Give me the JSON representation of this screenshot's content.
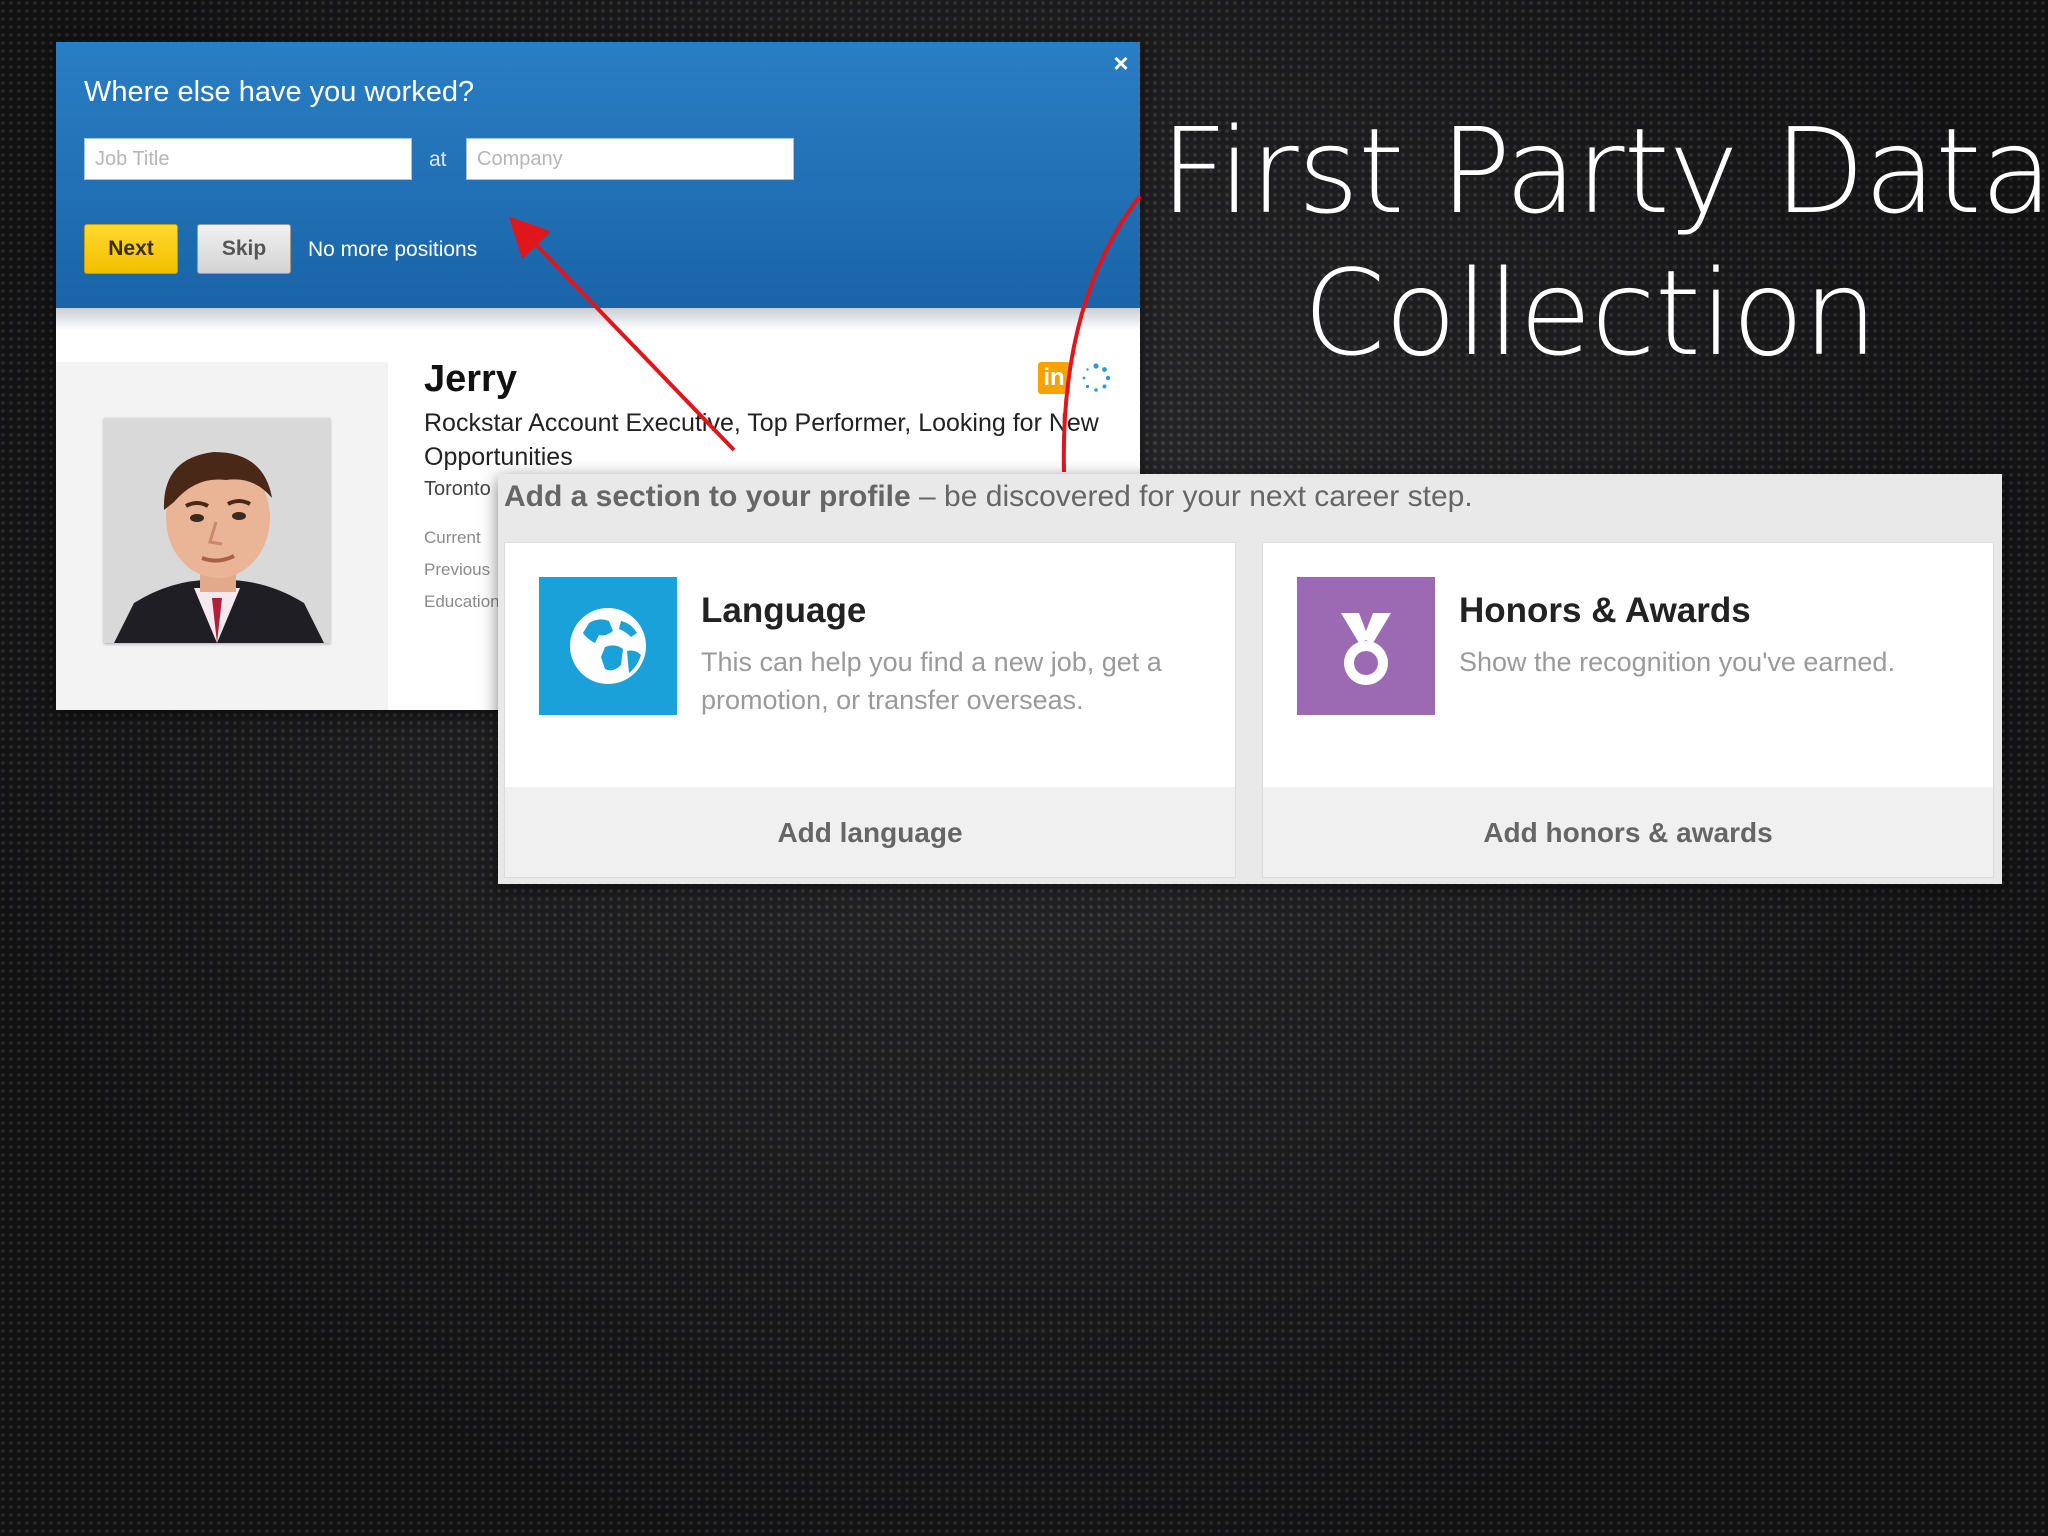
{
  "slide": {
    "title_line1": "First Party Data",
    "title_line2": "Collection"
  },
  "positions_prompt": {
    "title": "Where else have you worked?",
    "job_title_placeholder": "Job Title",
    "at_label": "at",
    "company_placeholder": "Company",
    "next_label": "Next",
    "skip_label": "Skip",
    "no_more_label": "No more positions",
    "close_icon": "×"
  },
  "profile": {
    "name": "Jerry",
    "headline": "Rockstar Account Executive, Top Performer, Looking for New Opportunities",
    "location": "Toronto",
    "meta_labels": [
      "Current",
      "Previous",
      "Education"
    ],
    "badge": "in"
  },
  "add_section": {
    "header_bold": "Add a section to your profile",
    "header_rest": " – be discovered for your next career step.",
    "cards": [
      {
        "title": "Language",
        "description": "This can help you find a new job, get a promotion, or transfer overseas.",
        "action": "Add language",
        "icon": "globe-icon",
        "icon_color": "#1aa1d9"
      },
      {
        "title": "Honors & Awards",
        "description": "Show the recognition you've earned.",
        "action": "Add honors & awards",
        "icon": "medal-icon",
        "icon_color": "#9b6ab3"
      }
    ]
  },
  "colors": {
    "linkedin_blue": "#1f6fb5",
    "arrow_red": "#e0161c",
    "next_yellow": "#f7cb10"
  }
}
